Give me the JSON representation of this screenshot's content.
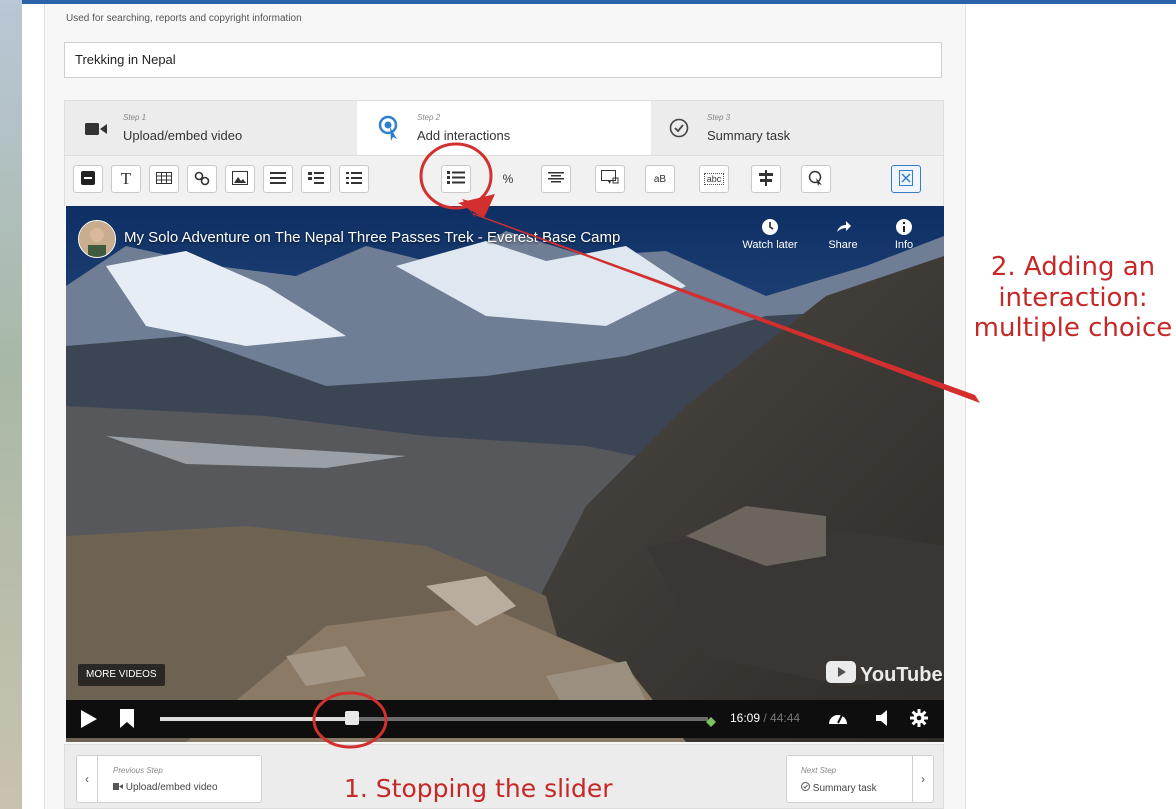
{
  "editor": {
    "help_text": "Used for searching, reports and copyright information",
    "title_value": "Trekking in Nepal"
  },
  "steps": [
    {
      "number": "Step 1",
      "label": "Upload/embed video",
      "icon": "video-camera-icon"
    },
    {
      "number": "Step 2",
      "label": "Add interactions",
      "icon": "interaction-icon"
    },
    {
      "number": "Step 3",
      "label": "Summary task",
      "icon": "check-circle-icon"
    }
  ],
  "toolbar": {
    "text_button_label": "T",
    "percent_button_label": "%",
    "fill_blanks_label": "aB",
    "drag_text_label": "abc"
  },
  "video": {
    "title": "My Solo Adventure on The Nepal Three Passes Trek - Everest Base Camp",
    "watch_later": "Watch later",
    "share": "Share",
    "info": "Info",
    "more_videos": "MORE VIDEOS",
    "youtube_logo": "YouTube",
    "current_time": "16:09",
    "duration": "44:44",
    "progress_fraction": 0.35
  },
  "footer": {
    "previous_small": "Previous Step",
    "previous_big": "Upload/embed video",
    "next_small": "Next Step",
    "next_big": "Summary task"
  },
  "annotations": {
    "interaction_note": "2.  Adding an interaction: multiple choice",
    "slider_note": "1. Stopping the slider"
  },
  "colors": {
    "annotation_red": "#d32f2f",
    "active_step_blue": "#2f7fd1"
  }
}
